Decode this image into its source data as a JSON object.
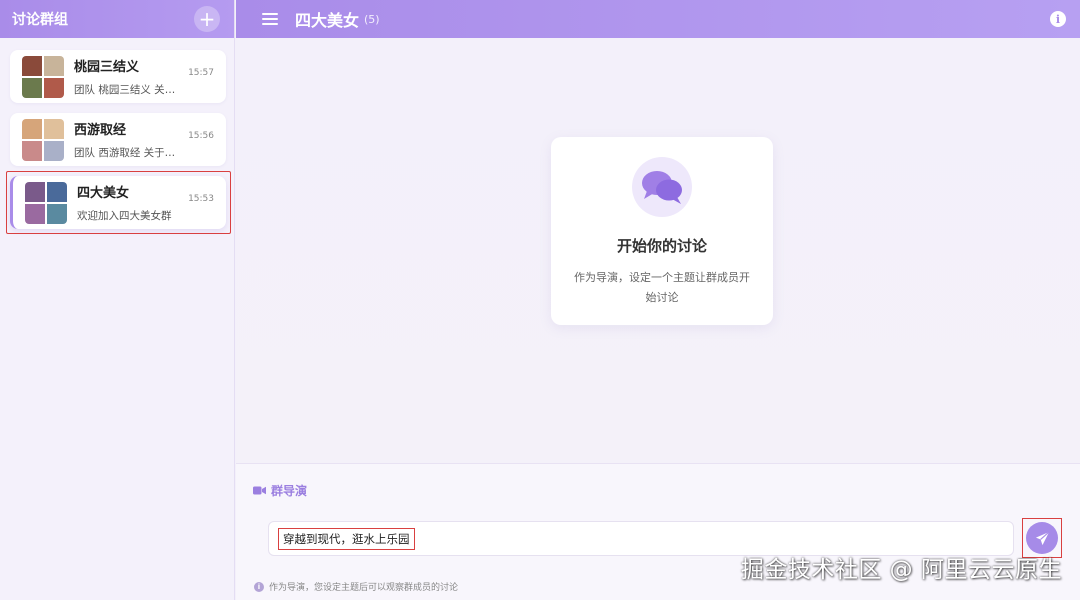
{
  "sidebar": {
    "title": "讨论群组",
    "add_label": "+",
    "items": [
      {
        "name": "桃园三结义",
        "preview": "团队 桃园三结义 关于…",
        "time": "15:57",
        "avatar_colors": [
          "#8a4a3a",
          "#c8b49a",
          "#6b7a4d",
          "#b05a4a"
        ]
      },
      {
        "name": "西游取经",
        "preview": "团队 西游取经 关于…",
        "time": "15:56",
        "avatar_colors": [
          "#d6a57a",
          "#e0c09b",
          "#c98a8a",
          "#a9b0c8"
        ]
      },
      {
        "name": "四大美女",
        "preview": "欢迎加入四大美女群",
        "time": "15:53",
        "avatar_colors": [
          "#7a5a8a",
          "#4a6a9a",
          "#9a6aa0",
          "#5a8aa0"
        ]
      }
    ]
  },
  "topbar": {
    "title": "四大美女",
    "count": "(5)",
    "info_label": "i"
  },
  "empty": {
    "title": "开始你的讨论",
    "desc": "作为导演，设定一个主题让群成员开始讨论"
  },
  "composer": {
    "director_label": "群导演",
    "input_value": "穿越到现代，逛水上乐园",
    "hint": "作为导演，您设定主题后可以观察群成员的讨论",
    "hint_icon": "i"
  },
  "watermark": "掘金技术社区 @ 阿里云云原生",
  "colors": {
    "accent": "#a98ce9",
    "highlight_border": "#d94040"
  }
}
